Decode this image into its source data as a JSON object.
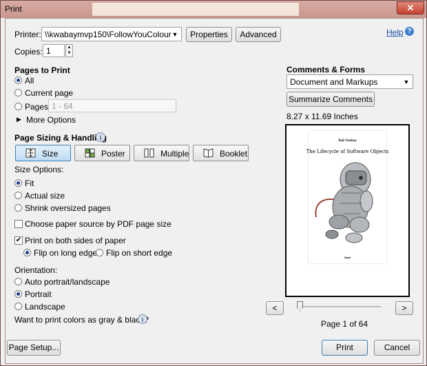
{
  "window": {
    "title": "Print",
    "close_label": "✕"
  },
  "printer": {
    "label": "Printer:",
    "value": "\\\\kwabaymvp150\\FollowYouColour",
    "properties": "Properties",
    "advanced": "Advanced",
    "help": "Help"
  },
  "copies": {
    "label": "Copies:",
    "value": "1"
  },
  "pages_to_print": {
    "heading": "Pages to Print",
    "all": "All",
    "current": "Current page",
    "pages": "Pages",
    "pages_placeholder": "1 - 64",
    "more_options": "More Options"
  },
  "sizing": {
    "heading": "Page Sizing & Handling",
    "tabs": [
      "Size",
      "Poster",
      "Multiple",
      "Booklet"
    ],
    "size_options_label": "Size Options:",
    "fit": "Fit",
    "actual": "Actual size",
    "shrink": "Shrink oversized pages",
    "paper_source": "Choose paper source by PDF page size",
    "both_sides": "Print on both sides of paper",
    "long_edge": "Flip on long edge",
    "short_edge": "Flip on short edge"
  },
  "orientation": {
    "label": "Orientation:",
    "auto": "Auto portrait/landscape",
    "portrait": "Portrait",
    "landscape": "Landscape"
  },
  "gray_question": "Want to print colors as gray & black?",
  "comments": {
    "heading": "Comments & Forms",
    "value": "Document and Markups",
    "summarize": "Summarize Comments",
    "paper_size": "8.27 x 11.69 Inches"
  },
  "preview": {
    "author": "Sal Gatoy",
    "title": "The Lifecycle of Software Objects",
    "footer": "Subt",
    "prev": "<",
    "next": ">",
    "page_indicator": "Page 1 of 64",
    "slider_position": 0.0
  },
  "footer": {
    "page_setup": "Page Setup...",
    "print": "Print",
    "cancel": "Cancel"
  }
}
